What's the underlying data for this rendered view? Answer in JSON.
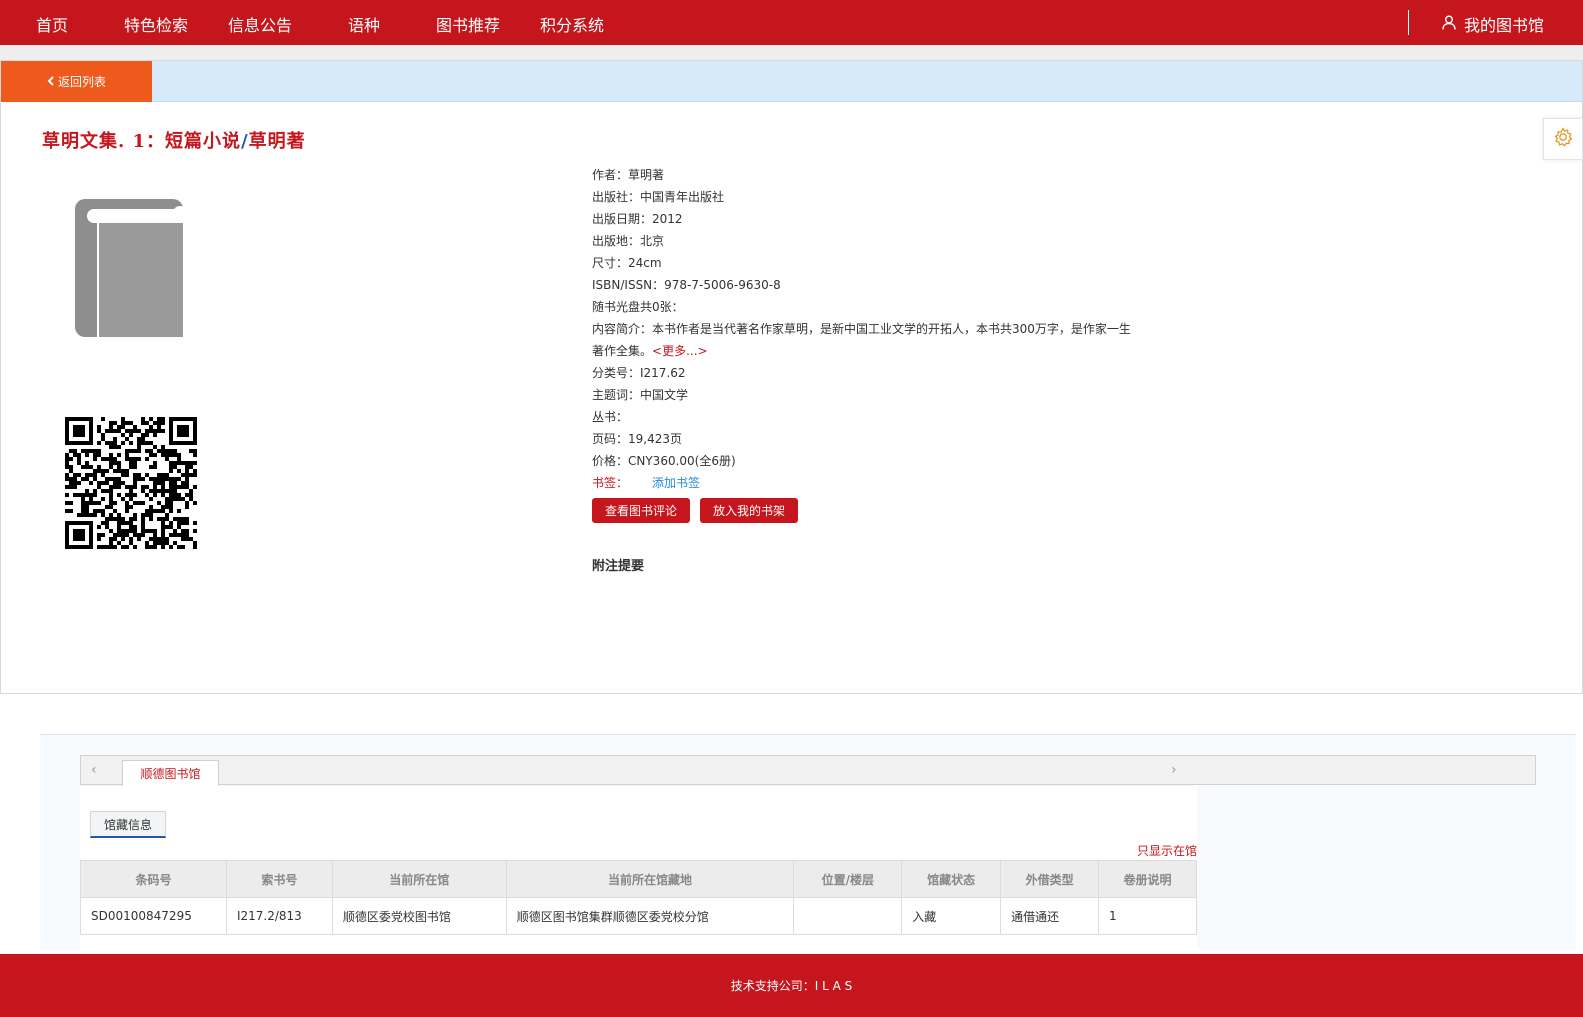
{
  "nav": {
    "items": [
      "首页",
      "特色检索",
      "信息公告",
      "语种",
      "图书推荐",
      "积分系统"
    ],
    "my_library": "我的图书馆"
  },
  "back_label": "返回列表",
  "book": {
    "title_main": "草明文集. 1：短篇小说",
    "title_sep": "/",
    "title_author": "草明著",
    "author": "作者：草明著",
    "publisher": "出版社：中国青年出版社",
    "pub_date": "出版日期：2012",
    "pub_place": "出版地：北京",
    "size": "尺寸：24cm",
    "isbn": "ISBN/ISSN：978-7-5006-9630-8",
    "disc": "随书光盘共0张：",
    "summary": "内容简介：本书作者是当代著名作家草明，是新中国工业文学的开拓人，本书共300万字，是作家一生著作全集。",
    "summary_more": "<更多...>",
    "class_no": "分类号：I217.62",
    "subject": "主题词：中国文学",
    "series": "丛书：",
    "pages": "页码：19,423页",
    "price": "价格：CNY360.00(全6册)",
    "bookmark_label": "书签：",
    "bookmark_add": "添加书签"
  },
  "actions": {
    "view_reviews": "查看图书评论",
    "add_shelf": "放入我的书架"
  },
  "notes_label": "附注提要",
  "holdings": {
    "library_tab": "顺德图书馆",
    "sub_tab": "馆藏信息",
    "only_in_library": "只显示在馆",
    "headers": [
      "条码号",
      "索书号",
      "当前所在馆",
      "当前所在馆藏地",
      "位置/楼层",
      "馆藏状态",
      "外借类型",
      "卷册说明"
    ],
    "rows": [
      [
        "SD00100847295",
        "I217.2/813",
        "顺德区委党校图书馆",
        "顺德区图书馆集群顺德区委党校分馆",
        "",
        "入藏",
        "通借通还",
        "1"
      ]
    ]
  },
  "footer": "技术支持公司：I L A S",
  "colors": {
    "brand_red": "#c4161c",
    "back_orange": "#ee5a1c",
    "light_blue": "#d6eafb"
  }
}
